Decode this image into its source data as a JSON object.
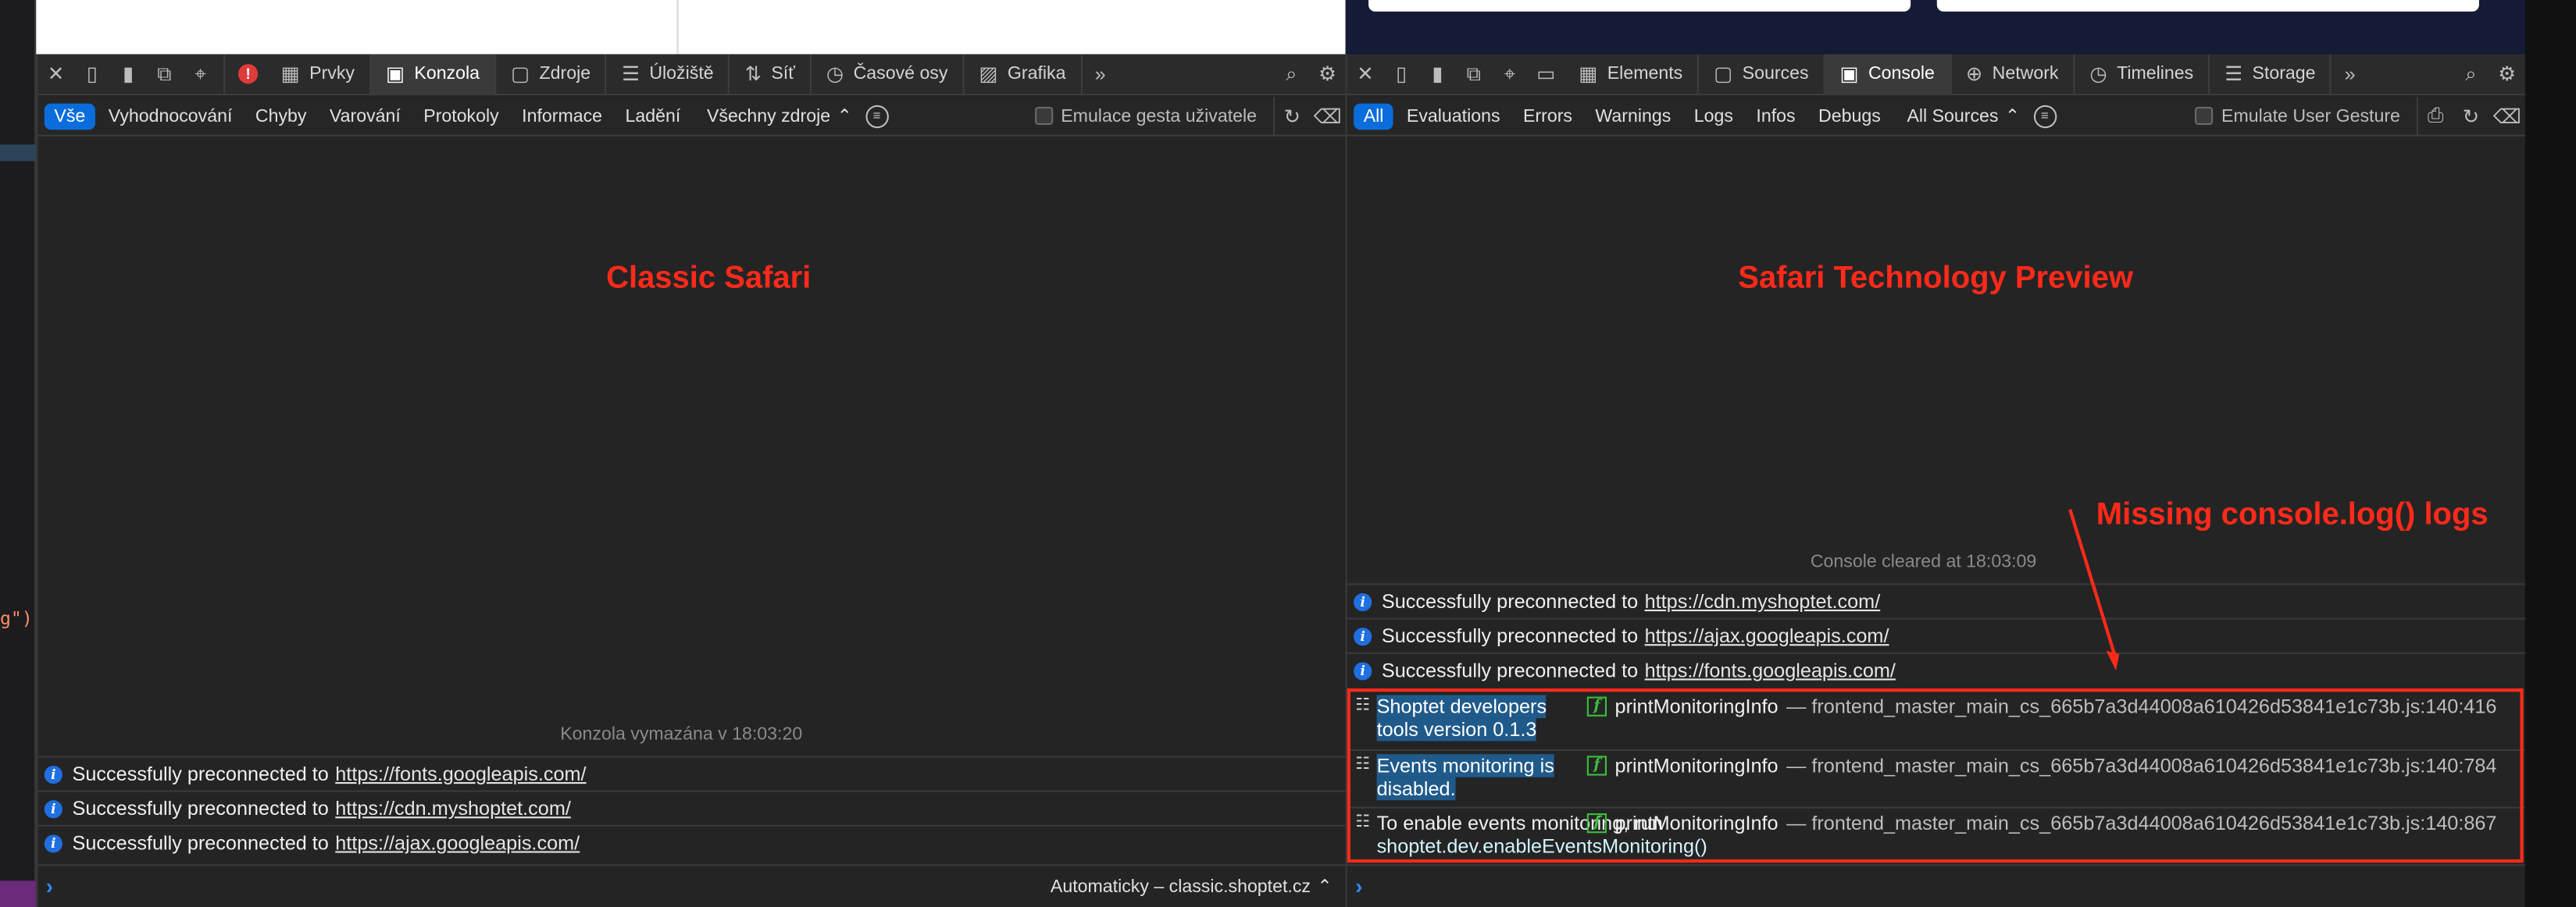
{
  "left_edge": {
    "code_text": "g\")"
  },
  "classic": {
    "annotation": "Classic Safari",
    "tabs": [
      {
        "label": "Prvky",
        "icon": "elements-icon"
      },
      {
        "label": "Konzola",
        "icon": "console-icon",
        "active": true
      },
      {
        "label": "Zdroje",
        "icon": "sources-icon"
      },
      {
        "label": "Úložiště",
        "icon": "storage-icon"
      },
      {
        "label": "Síť",
        "icon": "network-icon"
      },
      {
        "label": "Časové osy",
        "icon": "timelines-icon"
      },
      {
        "label": "Grafika",
        "icon": "graphics-icon"
      }
    ],
    "filters": [
      "Vše",
      "Vyhodnocování",
      "Chyby",
      "Varování",
      "Protokoly",
      "Informace",
      "Ladění"
    ],
    "source_select": "Všechny zdroje",
    "gesture_label": "Emulace gesta uživatele",
    "cleared": "Konzola vymazána v 18:03:20",
    "logs": [
      {
        "text": "Successfully preconnected to",
        "url": "https://fonts.googleapis.com/"
      },
      {
        "text": "Successfully preconnected to",
        "url": "https://cdn.myshoptet.com/"
      },
      {
        "text": "Successfully preconnected to",
        "url": "https://ajax.googleapis.com/"
      }
    ],
    "context": "Automaticky – classic.shoptet.cz"
  },
  "preview": {
    "annotation": "Safari Technology Preview",
    "missing_annotation": "Missing console.log() logs",
    "tabs": [
      {
        "label": "Elements",
        "icon": "elements-icon"
      },
      {
        "label": "Sources",
        "icon": "sources-icon"
      },
      {
        "label": "Console",
        "icon": "console-icon",
        "active": true
      },
      {
        "label": "Network",
        "icon": "network-icon"
      },
      {
        "label": "Timelines",
        "icon": "timelines-icon"
      },
      {
        "label": "Storage",
        "icon": "storage-icon"
      }
    ],
    "filters": [
      "All",
      "Evaluations",
      "Errors",
      "Warnings",
      "Logs",
      "Infos",
      "Debugs"
    ],
    "source_select": "All Sources",
    "gesture_label": "Emulate User Gesture",
    "cleared": "Console cleared at 18:03:09",
    "logs": [
      {
        "text": "Successfully preconnected to",
        "url": "https://cdn.myshoptet.com/"
      },
      {
        "text": "Successfully preconnected to",
        "url": "https://ajax.googleapis.com/"
      },
      {
        "text": "Successfully preconnected to",
        "url": "https://fonts.googleapis.com/"
      }
    ],
    "console_logs": [
      {
        "line1": "Shoptet developers",
        "line2": "tools version 0.1.3",
        "func": "printMonitoringInfo",
        "file": "— frontend_master_main_cs_665b7a3d44008a610426d53841e1c73b.js:140:416"
      },
      {
        "line1": "Events monitoring is",
        "line2": "disabled.",
        "func": "printMonitoringInfo",
        "file": "— frontend_master_main_cs_665b7a3d44008a610426d53841e1c73b.js:140:784"
      },
      {
        "line1": "To enable events monitoring, run",
        "line2": "shoptet.dev.enableEventsMonitoring()",
        "func": "printMonitoringInfo",
        "file": "— frontend_master_main_cs_665b7a3d44008a610426d53841e1c73b.js:140:867"
      }
    ]
  },
  "colors": {
    "accent": "#0a6ddb",
    "annotation_red": "#ff2a1a",
    "panel_bg": "#242424"
  }
}
